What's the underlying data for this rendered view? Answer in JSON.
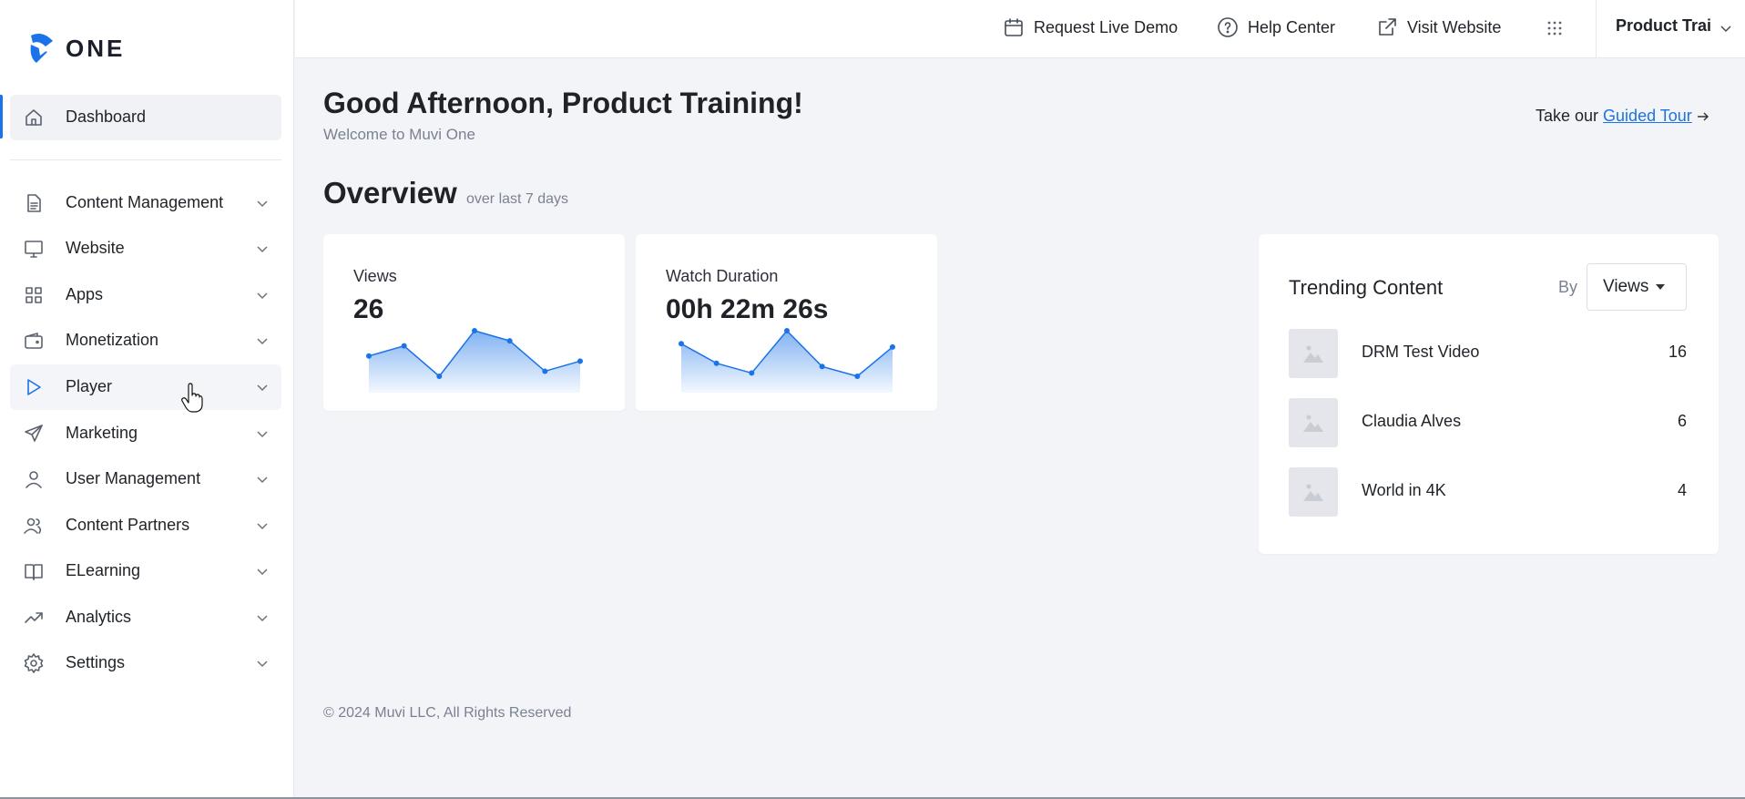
{
  "brand": {
    "logo_text": "ONE",
    "accent": "#1a73e8"
  },
  "sidebar": {
    "items": [
      {
        "label": "Dashboard",
        "icon": "home-icon"
      },
      {
        "label": "Content Management",
        "icon": "document-icon"
      },
      {
        "label": "Website",
        "icon": "monitor-icon"
      },
      {
        "label": "Apps",
        "icon": "apps-grid-icon"
      },
      {
        "label": "Monetization",
        "icon": "wallet-icon"
      },
      {
        "label": "Player",
        "icon": "play-icon"
      },
      {
        "label": "Marketing",
        "icon": "send-icon"
      },
      {
        "label": "User Management",
        "icon": "user-icon"
      },
      {
        "label": "Content Partners",
        "icon": "users-icon"
      },
      {
        "label": "ELearning",
        "icon": "book-icon"
      },
      {
        "label": "Analytics",
        "icon": "trend-icon"
      },
      {
        "label": "Settings",
        "icon": "gear-icon"
      }
    ]
  },
  "topbar": {
    "request_demo": "Request Live Demo",
    "help_center": "Help Center",
    "visit_website": "Visit Website",
    "user_name": "Product Trai"
  },
  "main": {
    "greeting": "Good Afternoon, Product Training!",
    "welcome": "Welcome to Muvi One",
    "tour_prefix": "Take our ",
    "tour_link": "Guided Tour",
    "overview_title": "Overview",
    "overview_sub": "over last 7 days"
  },
  "cards": {
    "views": {
      "title": "Views",
      "value": "26",
      "trend": [
        6,
        8,
        2,
        11,
        9,
        3,
        5
      ]
    },
    "watch": {
      "title": "Watch Duration",
      "value": "00h 22m 26s",
      "trend": [
        10,
        4,
        1,
        14,
        3,
        0,
        9
      ]
    }
  },
  "trending": {
    "title": "Trending Content",
    "by_label": "By",
    "selected": "Views",
    "items": [
      {
        "name": "DRM Test Video",
        "count": "16"
      },
      {
        "name": "Claudia Alves",
        "count": "6"
      },
      {
        "name": "World in 4K",
        "count": "4"
      }
    ]
  },
  "footer": {
    "copyright": "© 2024 Muvi LLC, All Rights Reserved"
  }
}
